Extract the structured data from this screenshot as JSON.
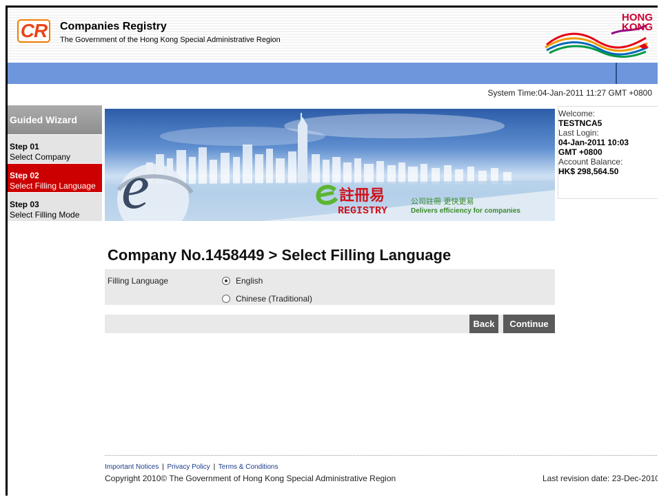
{
  "header": {
    "logo_text": "CR",
    "org_title": "Companies Registry",
    "org_subtitle": "The Government of the Hong Kong Special Administrative Region",
    "brand_line1": "HONG",
    "brand_line2": "KONG"
  },
  "system_time": "System Time:04-Jan-2011 11:27 GMT +0800",
  "sidebar": {
    "title": "Guided Wizard",
    "steps": [
      {
        "num": "Step 01",
        "label": "Select Company"
      },
      {
        "num": "Step 02",
        "label": "Select Filling Language"
      },
      {
        "num": "Step 03",
        "label": "Select Filling Mode"
      }
    ]
  },
  "banner": {
    "e_logo": "e",
    "chinese_title": "註冊易",
    "chinese_slogan": "公司註冊 更快更易",
    "registry": "REGISTRY",
    "slogan": "Delivers efficiency for companies"
  },
  "welcome": {
    "label": "Welcome:",
    "user": "TESTNCA5",
    "last_login_label": "Last Login:",
    "last_login_date": "04-Jan-2011 10:03",
    "last_login_tz": "GMT +0800",
    "balance_label": "Account Balance:",
    "balance": "HK$ 298,564.50"
  },
  "main": {
    "page_title": "Company No.1458449 > Select Filling Language",
    "field_label": "Filling Language",
    "options": [
      {
        "label": "English",
        "selected": true
      },
      {
        "label": "Chinese (Traditional)",
        "selected": false
      }
    ],
    "back_label": "Back",
    "continue_label": "Continue"
  },
  "footer": {
    "link_notices": "Important Notices",
    "link_privacy": "Privacy Policy",
    "link_terms": "Terms & Conditions",
    "separator": "|",
    "copyright": "Copyright 2010© The Government of Hong Kong Special Administrative Region",
    "revision": "Last revision date: 23-Dec-2010"
  },
  "colors": {
    "accent_red": "#cc0000",
    "nav_blue": "#6d96dc",
    "button_gray": "#5a5a5a"
  }
}
